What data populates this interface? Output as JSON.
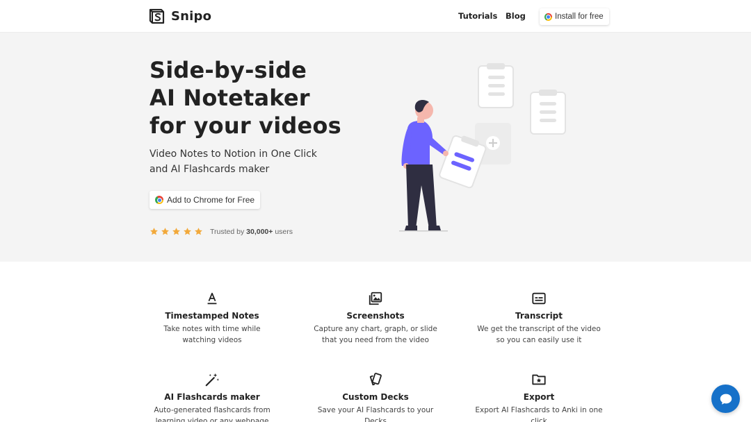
{
  "header": {
    "brand": "Snipo",
    "nav": {
      "tutorials": "Tutorials",
      "blog": "Blog"
    },
    "install_label": "Install for free"
  },
  "hero": {
    "title_lines": [
      "Side-by-side",
      "AI Notetaker",
      "for your videos"
    ],
    "subtitle_lines": [
      "Video Notes to Notion in One Click",
      "and AI Flashcards maker"
    ],
    "cta_label": "Add to Chrome for Free",
    "rating": {
      "stars": 5,
      "prefix": "Trusted by",
      "count": "30,000+",
      "suffix": "users"
    }
  },
  "features": [
    {
      "icon": "text-format-icon",
      "title": "Timestamped Notes",
      "desc": "Take notes with time while watching videos"
    },
    {
      "icon": "images-icon",
      "title": "Screenshots",
      "desc": "Capture any chart, graph, or slide that you need from the video"
    },
    {
      "icon": "subtitles-icon",
      "title": "Transcript",
      "desc": "We get the transcript of the video so you can easily use it"
    },
    {
      "icon": "magic-wand-icon",
      "title": "AI Flashcards maker",
      "desc": "Auto-generated flashcards from learning video or any webpage"
    },
    {
      "icon": "cards-icon",
      "title": "Custom Decks",
      "desc": "Save your AI Flashcards to your Decks"
    },
    {
      "icon": "folder-star-icon",
      "title": "Export",
      "desc": "Export AI Flashcards to Anki in one click"
    }
  ],
  "colors": {
    "accent": "#6c63ff",
    "star": "#f2a93b",
    "hero_bg": "#f4f4f4",
    "chat_button": "#1671c9"
  }
}
